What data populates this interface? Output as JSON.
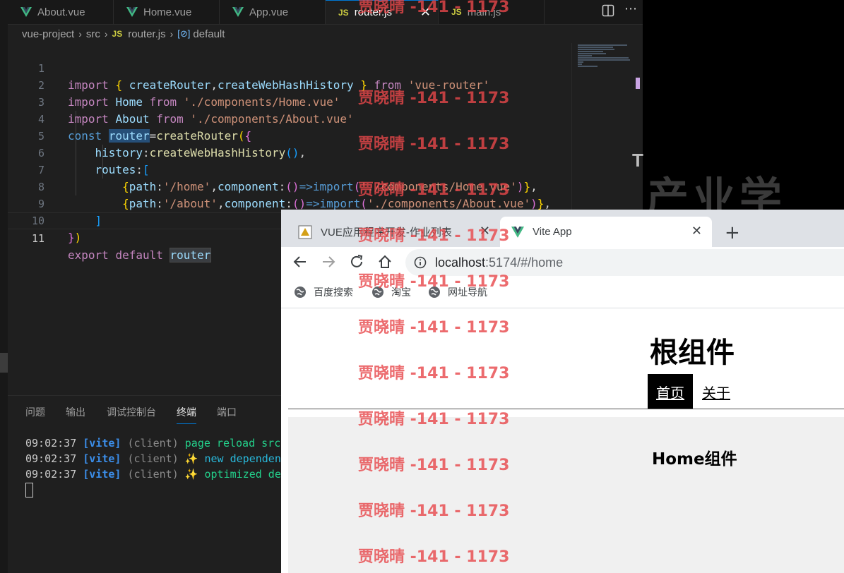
{
  "editor_tabs": [
    {
      "label": "About.vue",
      "icon": "vue-icon"
    },
    {
      "label": "Home.vue",
      "icon": "vue-icon"
    },
    {
      "label": "App.vue",
      "icon": "vue-icon"
    },
    {
      "label": "router.js",
      "icon": "js-icon",
      "active": true
    },
    {
      "label": "main.js",
      "icon": "js-icon"
    }
  ],
  "tab_close": "✕",
  "js_badge": "JS",
  "breadcrumb": {
    "project": "vue-project",
    "folder": "src",
    "file": "router.js",
    "symbol": "default"
  },
  "code": {
    "line_numbers": [
      "1",
      "2",
      "3",
      "4",
      "5",
      "6",
      "7",
      "8",
      "9",
      "10",
      "11"
    ],
    "l1": {
      "t1": "import",
      "t2": "{",
      "t3": "createRouter",
      "t4": ",",
      "t5": "createWebHashHistory",
      "t6": "}",
      "t7": "from",
      "t8": "'vue-router'"
    },
    "l2": {
      "t1": "import",
      "t2": "Home",
      "t3": "from",
      "t4": "'./components/Home.vue'"
    },
    "l3": {
      "t1": "import",
      "t2": "About",
      "t3": "from",
      "t4": "'./components/About.vue'"
    },
    "l4": {
      "t1": "const",
      "t2": "router",
      "t3": "=",
      "t4": "createRouter",
      "t5": "(",
      "t6": "{"
    },
    "l5": {
      "t1": "history",
      "t2": ":",
      "t3": "createWebHashHistory",
      "t4": "()",
      "t5": ","
    },
    "l6": {
      "t1": "routes",
      "t2": ":",
      "t3": "["
    },
    "l7": {
      "t1": "{",
      "t2": "path",
      "t3": ":",
      "t4": "'/home'",
      "t5": ",",
      "t6": "component",
      "t7": ":",
      "t8": "()",
      "t9": "=>",
      "t10": "import",
      "t11": "(",
      "t12": "'./components/Home.vue'",
      "t13": ")",
      "t14": "}",
      "t15": ","
    },
    "l8": {
      "t1": "{",
      "t2": "path",
      "t3": ":",
      "t4": "'/about'",
      "t5": ",",
      "t6": "component",
      "t7": ":",
      "t8": "()",
      "t9": "=>",
      "t10": "import",
      "t11": "(",
      "t12": "'./components/About.vue'",
      "t13": ")",
      "t14": "}",
      "t15": ","
    },
    "l9": {
      "t1": "]"
    },
    "l10": {
      "t1": "}",
      "t2": ")"
    },
    "l11": {
      "t1": "export",
      "t2": "default",
      "t3": "router"
    }
  },
  "panel_tabs": [
    "问题",
    "输出",
    "调试控制台",
    "终端",
    "端口"
  ],
  "terminal": [
    {
      "time": "09:02:37",
      "tag": "[vite]",
      "src": "(client)",
      "msg": "page reload src/"
    },
    {
      "time": "09:02:37",
      "tag": "[vite]",
      "src": "(client)",
      "msg": "✨ new dependen"
    },
    {
      "time": "09:02:37",
      "tag": "[vite]",
      "src": "(client)",
      "msg": "✨ optimized de"
    }
  ],
  "background_text": {
    "letter": "T",
    "chars": "产业学"
  },
  "browser": {
    "tabs": [
      {
        "label": "VUE应用程序开发-作业列表"
      },
      {
        "label": "Vite App",
        "active": true
      }
    ],
    "close": "✕",
    "new_tab": "+",
    "url_host": "localhost",
    "url_rest": ":5174/#/home",
    "bookmarks": [
      "百度搜索",
      "淘宝",
      "网址导航"
    ]
  },
  "page": {
    "title": "根组件",
    "nav": [
      "首页",
      "关于"
    ],
    "view_heading": "Home组件"
  },
  "watermark": "贾晓晴 -141 - 1173",
  "colors": {
    "accent": "#0078d4",
    "watermark": "#e8474a",
    "vue_green": "#41b883"
  }
}
